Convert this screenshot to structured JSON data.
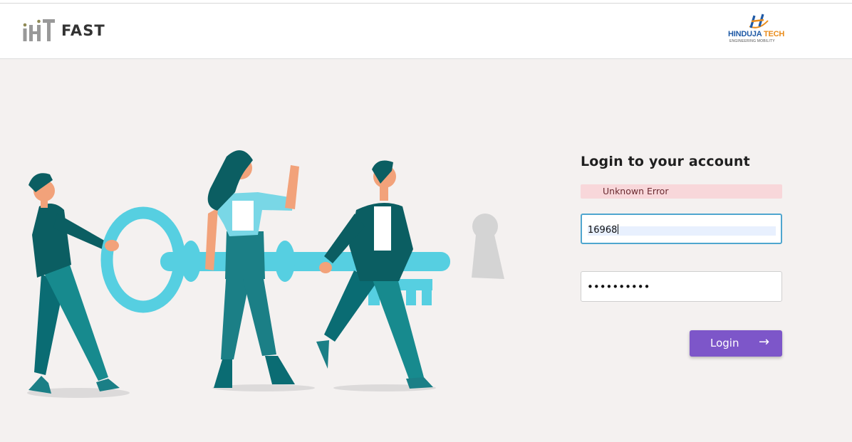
{
  "header": {
    "app_name": "FAST",
    "brand": {
      "name_main": "HINDUJA",
      "name_accent": "TECH",
      "tagline": "ENGINEERING MOBILITY"
    }
  },
  "login": {
    "title": "Login to your account",
    "error_message": "Unknown Error",
    "username_value": "16968",
    "password_value": "••••••••••",
    "submit_label": "Login",
    "submit_icon": "→"
  },
  "colors": {
    "accent": "#7d56c9",
    "error_bg": "#f8d7da",
    "focus_border": "#4fa6cf",
    "page_bg": "#f4f1f0",
    "key": "#56cfe1",
    "teal": "#1b7f86"
  },
  "icons": [
    "fast-logo-icon",
    "hinduja-tech-logo-icon",
    "arrow-right-icon"
  ]
}
